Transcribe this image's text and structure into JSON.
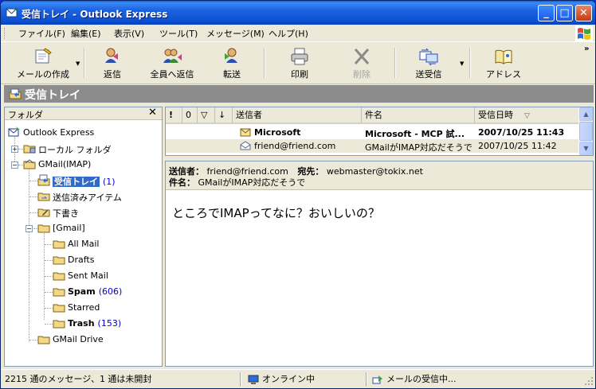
{
  "window": {
    "title": "受信トレイ - Outlook Express",
    "minimize": "_",
    "maximize": "□",
    "close": "✕"
  },
  "menu": {
    "items": [
      "ファイル(F)",
      "編集(E)",
      "表示(V)",
      "ツール(T)",
      "メッセージ(M)",
      "ヘルプ(H)"
    ]
  },
  "toolbar": {
    "compose": "メールの作成",
    "reply": "返信",
    "reply_all": "全員へ返信",
    "forward": "転送",
    "print": "印刷",
    "delete": "削除",
    "send_receive": "送受信",
    "addresses": "アドレス",
    "more": "»"
  },
  "folder_header": {
    "title": "受信トレイ"
  },
  "folder_pane": {
    "header": "フォルダ",
    "close": "✕",
    "tree": {
      "root": "Outlook Express",
      "local": "ローカル フォルダ",
      "gmail_imap": "GMail(IMAP)",
      "inbox": {
        "label": "受信トレイ",
        "count": "(1)"
      },
      "sent": "送信済みアイテム",
      "drafts_jp": "下書き",
      "gmail_folder": "[Gmail]",
      "all_mail": "All Mail",
      "drafts": "Drafts",
      "sent_mail": "Sent Mail",
      "spam": {
        "label": "Spam",
        "count": "(606)"
      },
      "starred": "Starred",
      "trash": {
        "label": "Trash",
        "count": "(153)"
      },
      "gmail_drive": "GMail Drive"
    }
  },
  "message_list": {
    "columns": {
      "priority": "!",
      "attachment": "0",
      "flag": "▽",
      "download": "↓",
      "from": "送信者",
      "subject": "件名",
      "received": "受信日時",
      "sort_indicator": "▽"
    },
    "rows": [
      {
        "from": "Microsoft",
        "subject": "Microsoft - MCP 試...",
        "received": "2007/10/25 11:43",
        "unread": true
      },
      {
        "from": "friend@friend.com",
        "subject": "GMailがIMAP対応だそうで",
        "received": "2007/10/25 11:42",
        "unread": false
      }
    ]
  },
  "preview": {
    "from_key": "送信者：",
    "from_value": "friend@friend.com",
    "to_key": "宛先：",
    "to_value": "webmaster@tokix.net",
    "subject_key": "件名：",
    "subject_value": "GMailがIMAP対応だそうで",
    "body": "ところでIMAPってなに？おいしいの？"
  },
  "status": {
    "messages": "2215 通のメッセージ、1 通は未開封",
    "online": "オンライン中",
    "receiving": "メールの受信中..."
  }
}
